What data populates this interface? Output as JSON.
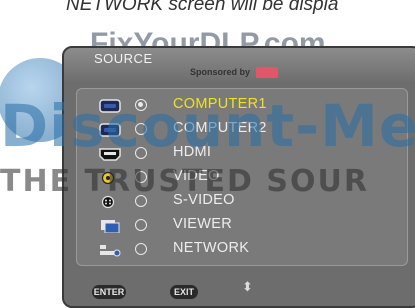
{
  "caption": "NETWORK screen will be displa",
  "watermark": {
    "site": "FixYourDLP.com",
    "brand": "Discount-Me",
    "tagline": "THE TRUSTED SOUR"
  },
  "osd": {
    "title": "SOURCE",
    "sponsored_text": "Sponsored by",
    "sources": [
      {
        "label": "COMPUTER1",
        "icon": "computer-icon",
        "selected": true
      },
      {
        "label": "COMPUTER2",
        "icon": "computer-icon",
        "selected": false
      },
      {
        "label": "HDMI",
        "icon": "hdmi-icon",
        "selected": false
      },
      {
        "label": "VIDEO",
        "icon": "video-icon",
        "selected": false
      },
      {
        "label": "S-VIDEO",
        "icon": "svideo-icon",
        "selected": false
      },
      {
        "label": "VIEWER",
        "icon": "viewer-icon",
        "selected": false
      },
      {
        "label": "NETWORK",
        "icon": "network-icon",
        "selected": false
      }
    ],
    "footer": {
      "enter_label": "ENTER",
      "exit_label": "EXIT",
      "updown_symbol": "⬍"
    },
    "colors": {
      "selected_text": "#f0e02a",
      "text": "#ededed",
      "panel": "#6d6d6d"
    }
  }
}
